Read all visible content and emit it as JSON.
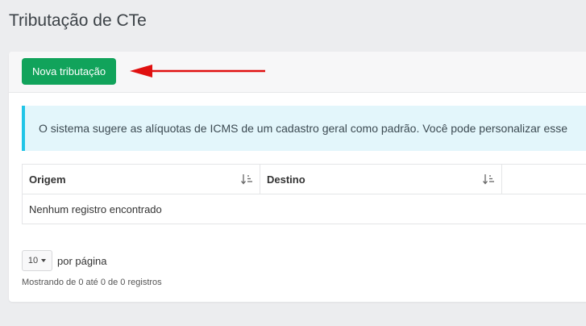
{
  "page": {
    "title": "Tributação de CTe"
  },
  "toolbar": {
    "new_button_label": "Nova tributação"
  },
  "alert": {
    "message": "O sistema sugere as alíquotas de ICMS de um cadastro geral como padrão. Você pode personalizar esse"
  },
  "table": {
    "columns": [
      {
        "label": "Origem"
      },
      {
        "label": "Destino"
      },
      {
        "label": ""
      }
    ],
    "empty_message": "Nenhum registro encontrado"
  },
  "pagination": {
    "page_size": "10",
    "per_page_label": "por página",
    "summary": "Mostrando de 0 até 0 de 0 registros"
  },
  "colors": {
    "primary_button": "#11a35b",
    "alert_border": "#22c5e7",
    "alert_background": "#e3f6fb",
    "arrow": "#e01010"
  },
  "icons": {
    "sort": "sort-amount-down-icon",
    "arrow": "arrow-left-icon",
    "caret": "caret-down-icon"
  }
}
